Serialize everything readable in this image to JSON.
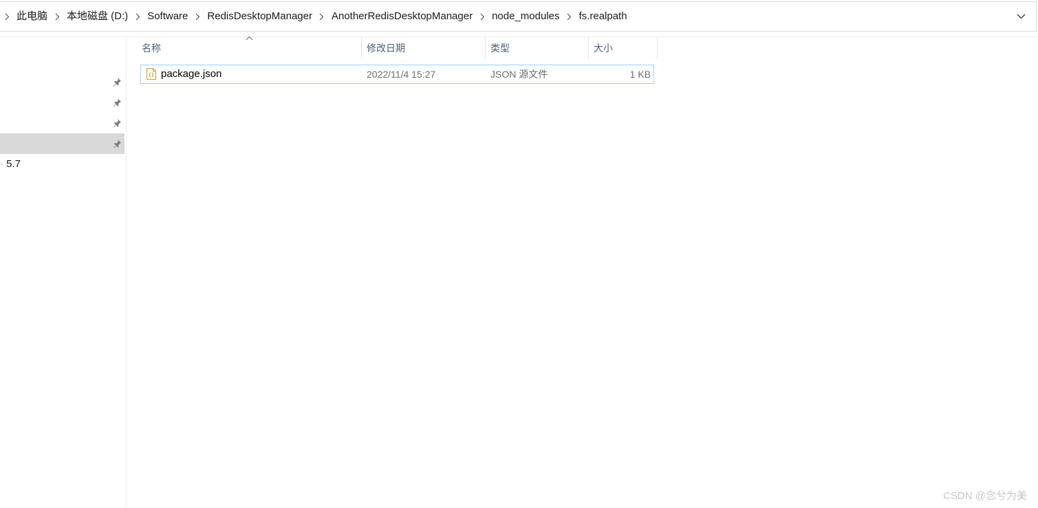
{
  "breadcrumb": {
    "items": [
      {
        "label": "此电脑"
      },
      {
        "label": "本地磁盘 (D:)"
      },
      {
        "label": "Software"
      },
      {
        "label": "RedisDesktopManager"
      },
      {
        "label": "AnotherRedisDesktopManager"
      },
      {
        "label": "node_modules"
      },
      {
        "label": "fs.realpath"
      }
    ]
  },
  "nav": {
    "partial_label": "5.7",
    "selected_index": 3
  },
  "columns": {
    "name": "名称",
    "modified": "修改日期",
    "type": "类型",
    "size": "大小"
  },
  "files": [
    {
      "name": "package.json",
      "modified": "2022/11/4 15:27",
      "type": "JSON 源文件",
      "size": "1 KB",
      "icon": "json-file-icon"
    }
  ],
  "watermark": "CSDN @念兮为美",
  "colors": {
    "selection_border": "#99d1ff",
    "selected_nav": "#d9d9d9",
    "header_text": "#4c607a"
  }
}
